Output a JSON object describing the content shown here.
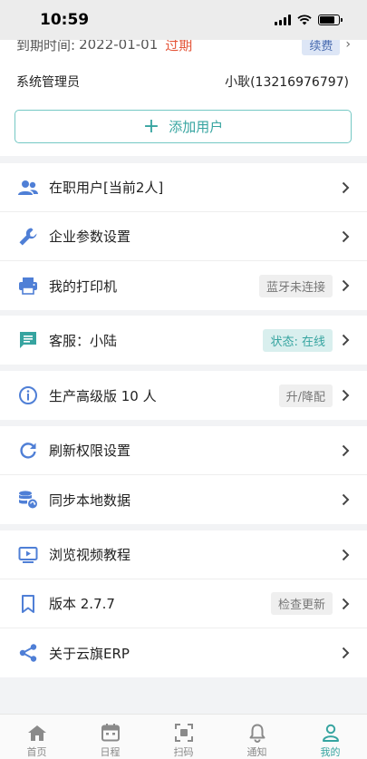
{
  "status_bar": {
    "time": "10:59"
  },
  "account": {
    "expire_label": "到期时间:",
    "expire_date": "2022-01-01",
    "expire_status": "过期",
    "renew_label": "续费",
    "role": "系统管理员",
    "user": "小耿(13216976797)",
    "add_user_label": "添加用户"
  },
  "menu": {
    "active_users": "在职用户[当前2人]",
    "enterprise_settings": "企业参数设置",
    "my_printer": "我的打印机",
    "printer_status": "蓝牙未连接",
    "customer_service": "客服：小陆",
    "service_status": "状态: 在线",
    "edition": "生产高级版 10 人",
    "edition_action": "升/降配",
    "refresh_permissions": "刷新权限设置",
    "sync_local_data": "同步本地数据",
    "video_tutorials": "浏览视频教程",
    "version": "版本 2.7.7",
    "check_update": "检查更新",
    "about": "关于云旗ERP"
  },
  "tabbar": {
    "items": [
      {
        "label": "首页",
        "icon": "home-icon"
      },
      {
        "label": "日程",
        "icon": "calendar-icon"
      },
      {
        "label": "扫码",
        "icon": "scan-icon"
      },
      {
        "label": "通知",
        "icon": "bell-icon"
      },
      {
        "label": "我的",
        "icon": "user-icon"
      }
    ],
    "active_index": 4
  },
  "colors": {
    "accent": "#36a4a0",
    "warning": "#e4563a",
    "icon_blue": "#4f7fd6"
  }
}
